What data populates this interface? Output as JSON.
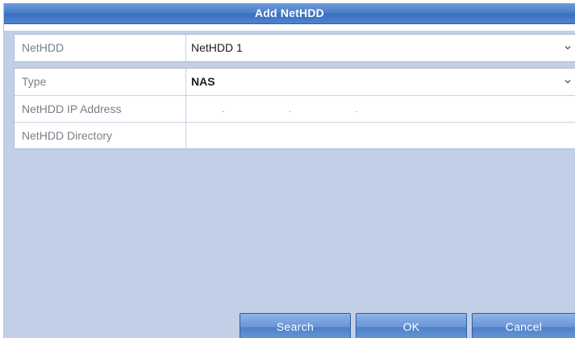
{
  "dialog": {
    "title": "Add NetHDD"
  },
  "fields": {
    "nethdd": {
      "label": "NetHDD",
      "value": "NetHDD 1"
    },
    "type": {
      "label": "Type",
      "value": "NAS"
    },
    "ip_address": {
      "label": "NetHDD IP Address",
      "value": ". . ."
    },
    "directory": {
      "label": "NetHDD Directory",
      "value": ""
    }
  },
  "buttons": {
    "search": "Search",
    "ok": "OK",
    "cancel": "Cancel"
  },
  "icons": {
    "dropdown": "chevron-down-icon"
  },
  "colors": {
    "title_bar": "#4a7fca",
    "dialog_bg": "#c3cfe6",
    "button": "#6a97d6"
  }
}
